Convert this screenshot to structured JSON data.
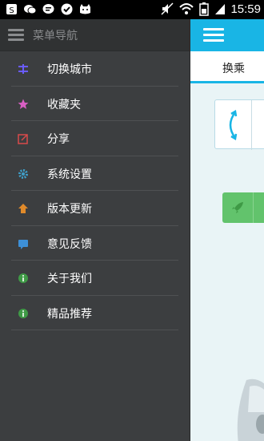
{
  "status_bar": {
    "time": "15:59",
    "left_icons": [
      "notification-icon",
      "wechat-icon",
      "message-icon",
      "check-icon",
      "cat-icon"
    ],
    "right_icons": [
      "mute-icon",
      "wifi-icon",
      "battery-icon",
      "signal-icon"
    ]
  },
  "drawer": {
    "title": "菜单导航",
    "items": [
      {
        "label": "切换城市",
        "icon": "switch-city-icon",
        "color": "#6a5cff"
      },
      {
        "label": "收藏夹",
        "icon": "star-icon",
        "color": "#d85fc3"
      },
      {
        "label": "分享",
        "icon": "share-icon",
        "color": "#d84a4a"
      },
      {
        "label": "系统设置",
        "icon": "gear-icon",
        "color": "#3f9fc9"
      },
      {
        "label": "版本更新",
        "icon": "upload-icon",
        "color": "#e08a2a"
      },
      {
        "label": "意见反馈",
        "icon": "feedback-icon",
        "color": "#3d8fd6"
      },
      {
        "label": "关于我们",
        "icon": "info-icon",
        "color": "#3f9a46"
      },
      {
        "label": "精品推荐",
        "icon": "recommend-icon",
        "color": "#3f9a46"
      }
    ]
  },
  "main": {
    "tab_label": "换乘",
    "accent": "#19b5e5",
    "button_color": "#62c36c"
  }
}
